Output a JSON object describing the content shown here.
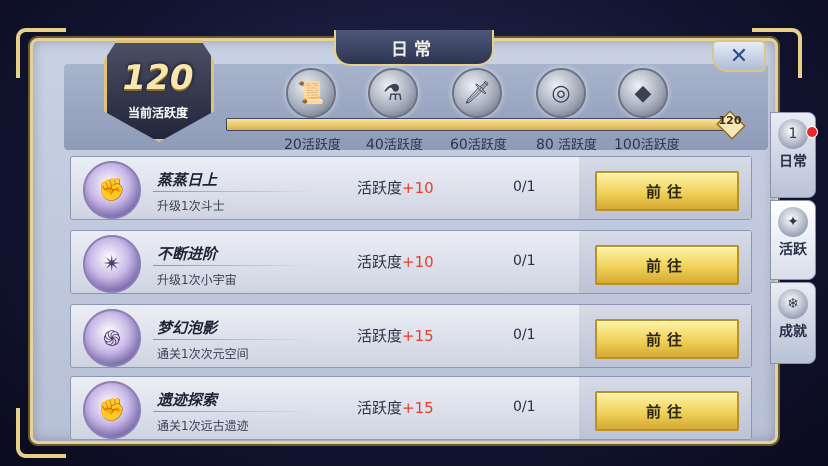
{
  "dialog": {
    "title": "日常",
    "close_glyph": "✕"
  },
  "activity": {
    "current_points": "120",
    "label": "当前活跃度",
    "max_points": "120",
    "progress_fraction": 1.0
  },
  "milestones": [
    {
      "value": "20",
      "unit": "活跃度",
      "icon": "scroll-icon",
      "glyph": "📜"
    },
    {
      "value": "40",
      "unit": "活跃度",
      "icon": "potion-icon",
      "glyph": "⚗"
    },
    {
      "value": "60",
      "unit": "活跃度",
      "icon": "sword-icon",
      "glyph": "🗡"
    },
    {
      "value": "80",
      "unit": "活跃度",
      "icon": "coin-icon",
      "glyph": "◎"
    },
    {
      "value": "100",
      "unit": "活跃度",
      "icon": "diamond-icon",
      "glyph": "◆"
    }
  ],
  "tasks": [
    {
      "name": "蒸蒸日上",
      "desc": "升级1次斗士",
      "points_label": "活跃度",
      "points": "+10",
      "progress": "0/1",
      "button": "前往",
      "icon": "fist-icon",
      "glyph": "✊"
    },
    {
      "name": "不断进阶",
      "desc": "升级1次小宇宙",
      "points_label": "活跃度",
      "points": "+10",
      "progress": "0/1",
      "button": "前往",
      "icon": "cosmo-icon",
      "glyph": "✴"
    },
    {
      "name": "梦幻泡影",
      "desc": "通关1次次元空间",
      "points_label": "活跃度",
      "points": "+15",
      "progress": "0/1",
      "button": "前往",
      "icon": "vortex-icon",
      "glyph": "֍"
    },
    {
      "name": "遗迹探索",
      "desc": "通关1次远古遗迹",
      "points_label": "活跃度",
      "points": "+15",
      "progress": "0/1",
      "button": "前往",
      "icon": "fist-icon",
      "glyph": "✊"
    }
  ],
  "side_tabs": [
    {
      "label": "日常",
      "icon": "daily-icon",
      "glyph": "1"
    },
    {
      "label": "活跃",
      "icon": "activity-icon",
      "glyph": "✦"
    },
    {
      "label": "成就",
      "icon": "achievement-icon",
      "glyph": "❄"
    }
  ],
  "colors": {
    "accent_gold": "#f0d25a",
    "plus_red": "#e0402c",
    "frame_gold": "#e3d29a"
  }
}
